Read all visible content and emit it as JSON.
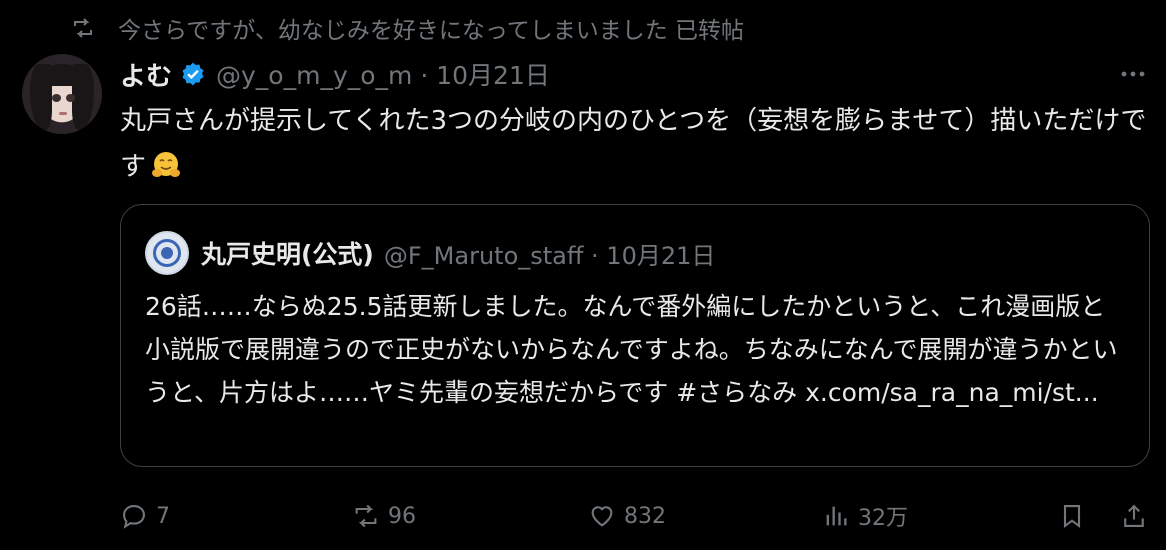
{
  "repost_banner": {
    "text": "今さらですが、幼なじみを好きになってしまいました 已转帖"
  },
  "tweet": {
    "author_name": "よむ",
    "meta": "@y_o_m_y_o_m · 10月21日",
    "text": "丸戸さんが提示してくれた3つの分岐の内のひとつを（妄想を膨らませて）描いただけです"
  },
  "quote": {
    "author_name": "丸戸史明(公式)",
    "meta": "@F_Maruto_staff · 10月21日",
    "text": "26話……ならぬ25.5話更新しました。なんで番外編にしたかというと、これ漫画版と小説版で展開違うので正史がないからなんですよね。ちなみになんで展開が違うかというと、片方はよ……ヤミ先輩の妄想だからです #さらなみ x.com/sa_ra_na_mi/st..."
  },
  "actions": {
    "replies": "7",
    "reposts": "96",
    "likes": "832",
    "views": "32万"
  },
  "icons": {
    "repost": "repost-icon",
    "verified": "verified-badge-icon",
    "more": "more-icon",
    "emoji": "hugging-face-emoji",
    "reply": "reply-icon",
    "like": "heart-icon",
    "views": "views-icon",
    "bookmark": "bookmark-icon",
    "share": "share-icon"
  },
  "colors": {
    "accent": "#1d9bf0",
    "muted": "#71767b",
    "text": "#e7e9ea",
    "background": "#000000"
  }
}
